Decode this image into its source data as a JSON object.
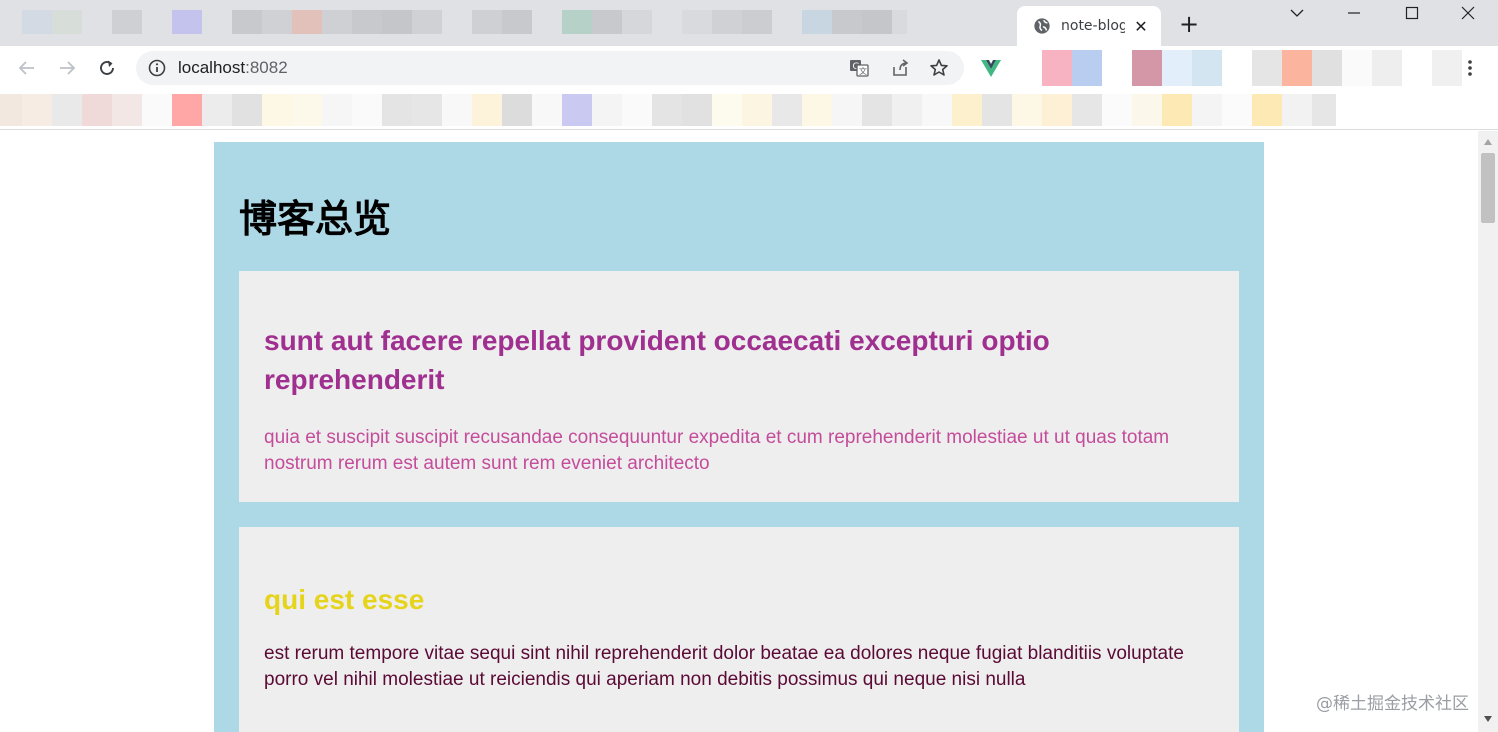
{
  "browser": {
    "tab_title": "note-blog",
    "address_host": "localhost",
    "address_port": ":8082",
    "colors": {
      "tabstrip": "#dfe1e5",
      "omnibox": "#f1f3f4"
    }
  },
  "page": {
    "heading": "博客总览",
    "background_color": "#add8e6",
    "card_color": "#eeeeee",
    "posts": [
      {
        "title": "sunt aut facere repellat provident occaecati excepturi optio reprehenderit",
        "body": "quia et suscipit suscipit recusandae consequuntur expedita et cum reprehenderit molestiae ut ut quas totam nostrum rerum est autem sunt rem eveniet architecto",
        "title_color": "#a0308f",
        "body_color": "#c44c9b"
      },
      {
        "title": "qui est esse",
        "body": "est rerum tempore vitae sequi sint nihil reprehenderit dolor beatae ea dolores neque fugiat blanditiis voluptate porro vel nihil molestiae ut reiciendis qui aperiam non debitis possimus qui neque nisi nulla",
        "title_color": "#e6d41c",
        "body_color": "#5a0a35"
      }
    ]
  },
  "watermark": "@稀土掘金技术社区"
}
